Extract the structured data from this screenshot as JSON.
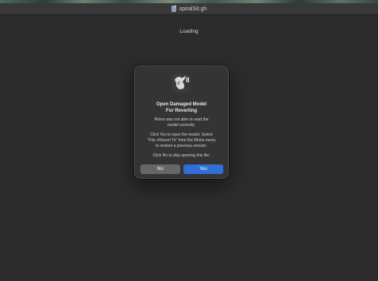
{
  "window": {
    "title": "spiralSit.gh",
    "status_text": "Loading"
  },
  "dialog": {
    "app_icon": "rhino-8-icon",
    "title_line1": "Open Damaged Model",
    "title_line2": "For Reverting",
    "message1_line1": "Rhino was not able to read the",
    "message1_line2": "model correctly.",
    "message2_line1": "Click Yes to open the model. Select",
    "message2_line2": "\"File->Revert To\" from the Rhino menu",
    "message2_line3": "to restore a previous version.",
    "message3": "Click No to skip opening this file.",
    "no_label": "No",
    "yes_label": "Yes"
  },
  "colors": {
    "background": "#2c2c2c",
    "dialog": "#343434",
    "yes_button": "#2f6fd6",
    "no_button": "#666666"
  }
}
